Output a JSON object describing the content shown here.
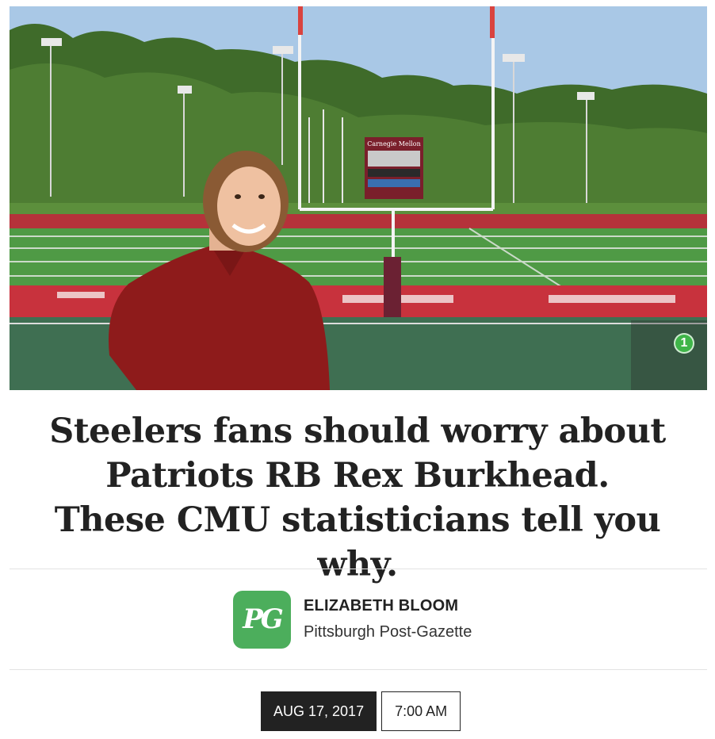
{
  "hero": {
    "scoreboard_text": "Carnegie Mellon",
    "photo_count": "1"
  },
  "article": {
    "headline": "Steelers fans should worry about Patriots RB Rex Burkhead. These CMU statisticians tell you why."
  },
  "byline": {
    "logo_text": "PG",
    "author_name": "ELIZABETH BLOOM",
    "publication": "Pittsburgh Post-Gazette"
  },
  "dateline": {
    "date": "AUG 17, 2017",
    "time": "7:00 AM"
  },
  "colors": {
    "logo_green": "#4cae5c",
    "badge_green": "#3fb549",
    "date_bg": "#222222"
  }
}
